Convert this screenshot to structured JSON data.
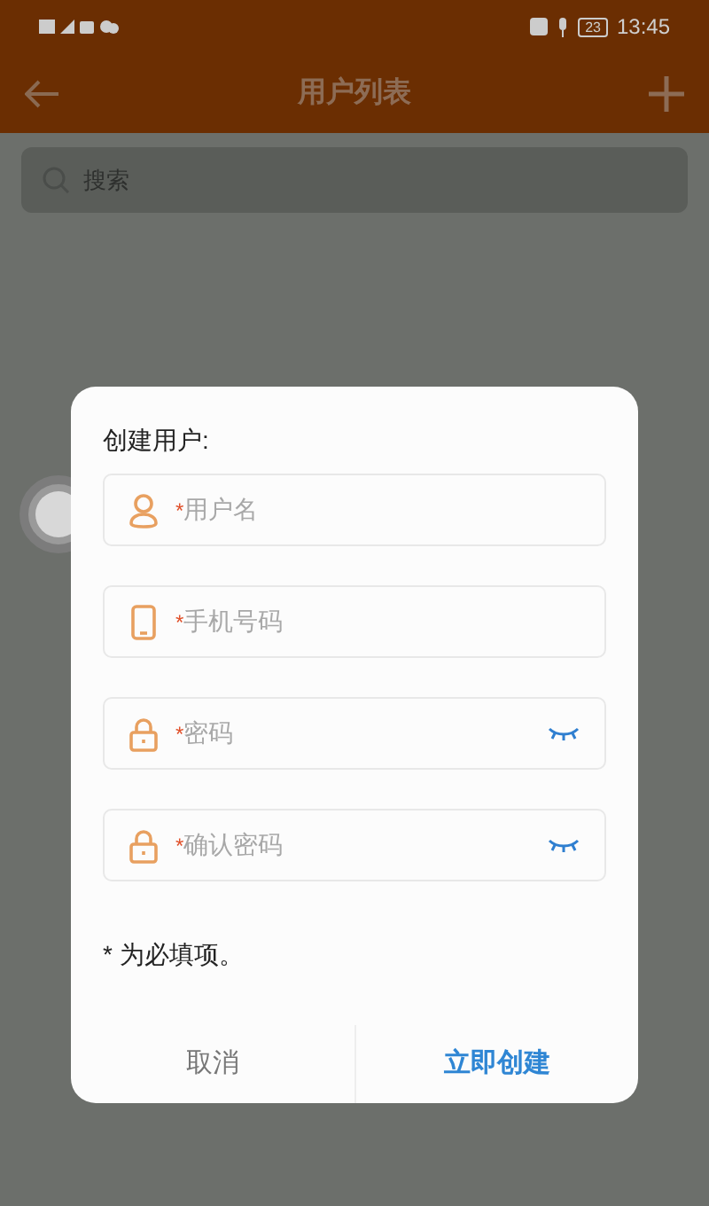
{
  "status_bar": {
    "time": "13:45",
    "battery": "23"
  },
  "app_bar": {
    "title": "用户列表"
  },
  "search": {
    "placeholder": "搜索"
  },
  "dialog": {
    "title": "创建用户:",
    "fields": [
      {
        "kind": "user",
        "marker": "*",
        "placeholder": "用户名",
        "toggle": false
      },
      {
        "kind": "phone",
        "marker": "*",
        "placeholder": "手机号码",
        "toggle": false
      },
      {
        "kind": "password",
        "marker": "*",
        "placeholder": "密码",
        "toggle": true
      },
      {
        "kind": "password",
        "marker": "*",
        "placeholder": "确认密码",
        "toggle": true
      }
    ],
    "note": "* 为必填项。",
    "buttons": [
      {
        "label": "取消",
        "primary": false
      },
      {
        "label": "立即创建",
        "primary": true
      }
    ]
  }
}
